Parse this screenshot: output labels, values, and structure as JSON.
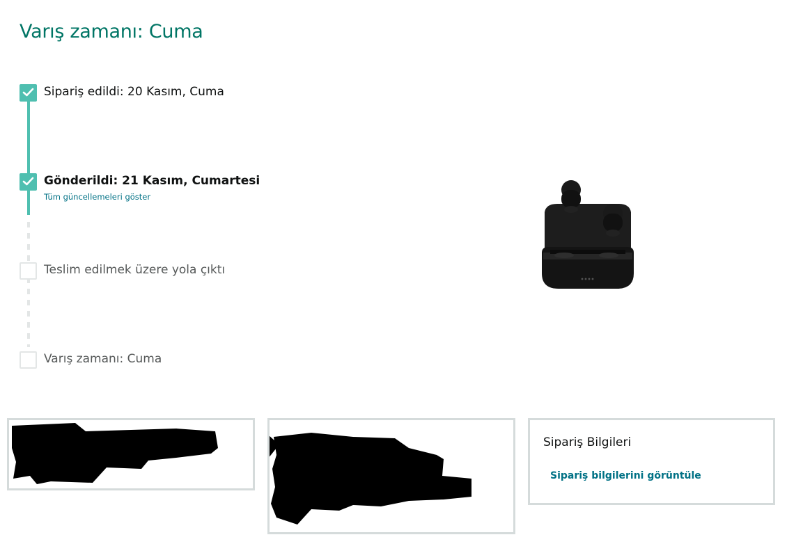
{
  "header": {
    "arrival_title": "Varış zamanı: Cuma"
  },
  "tracker": {
    "steps": [
      {
        "label": "Sipariş edildi: 20 Kasım, Cuma",
        "status": "done"
      },
      {
        "label": "Gönderildi: 21 Kasım, Cumartesi",
        "status": "done",
        "link": "Tüm güncellemeleri göster"
      },
      {
        "label": "Teslim edilmek üzere yola çıktı",
        "status": "pending"
      },
      {
        "label": "Varış zamanı: Cuma",
        "status": "pending"
      }
    ],
    "colors": {
      "done": "#4fbfb0",
      "pending": "#e3e6e6",
      "link": "#007185",
      "title": "#007565"
    }
  },
  "product": {
    "image": "wireless-earbuds-charging-case"
  },
  "cards": {
    "order_info": {
      "title": "Sipariş Bilgileri",
      "link": "Sipariş bilgilerini görüntüle"
    }
  }
}
